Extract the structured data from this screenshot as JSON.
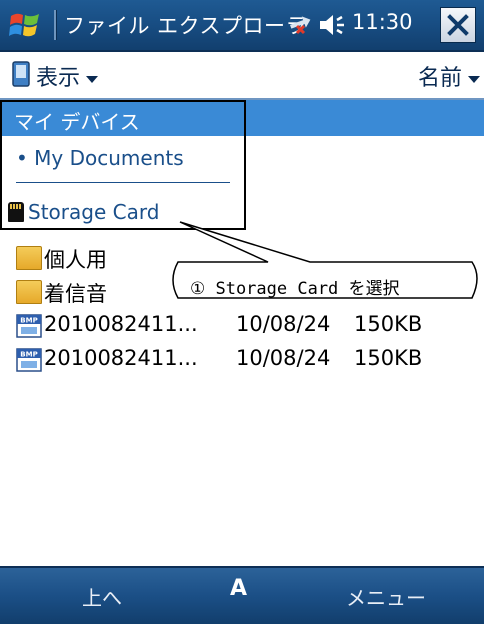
{
  "titlebar": {
    "title": "ファイル エクスプローラ",
    "time": "11:30"
  },
  "header": {
    "view_menu": "表示",
    "sort_menu": "名前"
  },
  "dropdown": {
    "items": [
      {
        "label": "マイ デバイス",
        "selected": true
      },
      {
        "label": "• My Documents",
        "selected": false
      },
      {
        "label": "Storage Card",
        "selected": false
      }
    ]
  },
  "files": [
    {
      "type": "folder",
      "name": "個人用",
      "date": "",
      "size": ""
    },
    {
      "type": "folder",
      "name": "着信音",
      "date": "",
      "size": ""
    },
    {
      "type": "bmp",
      "name": "2010082411...",
      "date": "10/08/24",
      "size": "150KB"
    },
    {
      "type": "bmp",
      "name": "2010082411...",
      "date": "10/08/24",
      "size": "150KB"
    }
  ],
  "callout": {
    "text": "① Storage Card を選択"
  },
  "softkeys": {
    "left": "上へ",
    "center": "A",
    "right": "メニュー"
  },
  "colors": {
    "titlebar": "#184e84",
    "highlight": "#3a8ad6",
    "link_text": "#1a4f8a"
  }
}
